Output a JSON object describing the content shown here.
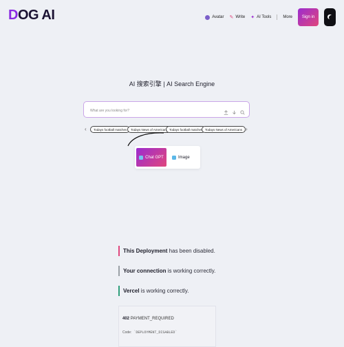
{
  "header": {
    "logo": {
      "mark": "D",
      "text": "OG AI"
    },
    "nav": [
      {
        "label": "Avatar",
        "icon": "avatar-icon",
        "color": "#7b5fc9"
      },
      {
        "label": "Write",
        "icon": "pencil-icon",
        "color": "#e0467c"
      },
      {
        "label": "AI Tools",
        "icon": "tools-icon",
        "color": "#9b2ccf"
      },
      {
        "label": "More",
        "icon": "more-icon",
        "color": "#555555"
      }
    ],
    "signin_label": "Sign in",
    "theme_toggle_icon": "moon-icon"
  },
  "search": {
    "title": "AI 搜索引擎 | AI Search Engine",
    "placeholder": "What are you looking for?",
    "value": "",
    "icons": [
      "upload-icon",
      "download-icon",
      "search-icon"
    ]
  },
  "suggestions": [
    "Todays football matches",
    "Todays News of Americans",
    "Todays football matches",
    "Todays News of Americans"
  ],
  "generators": [
    {
      "label": "Chat GPT",
      "icon": "chatgpt-icon",
      "active": true
    },
    {
      "label": "Image",
      "icon": "image-icon",
      "active": false
    }
  ],
  "deployment": {
    "messages": [
      {
        "bold": "This Deployment",
        "rest": " has been disabled.",
        "color": "#e0467c"
      },
      {
        "bold": "Your connection",
        "rest": " is working correctly.",
        "color": "#9aa0a6"
      },
      {
        "bold": "Vercel",
        "rest": " is working correctly.",
        "color": "#2e9e7a"
      }
    ],
    "error": {
      "code": "402",
      "status": "PAYMENT_REQUIRED",
      "code_label": "Code:",
      "code_value": "`DEPLOYMENT_DISABLED`"
    }
  },
  "colors": {
    "accent_start": "#9b2ccf",
    "accent_end": "#e0467c",
    "background": "#eef0f5"
  }
}
